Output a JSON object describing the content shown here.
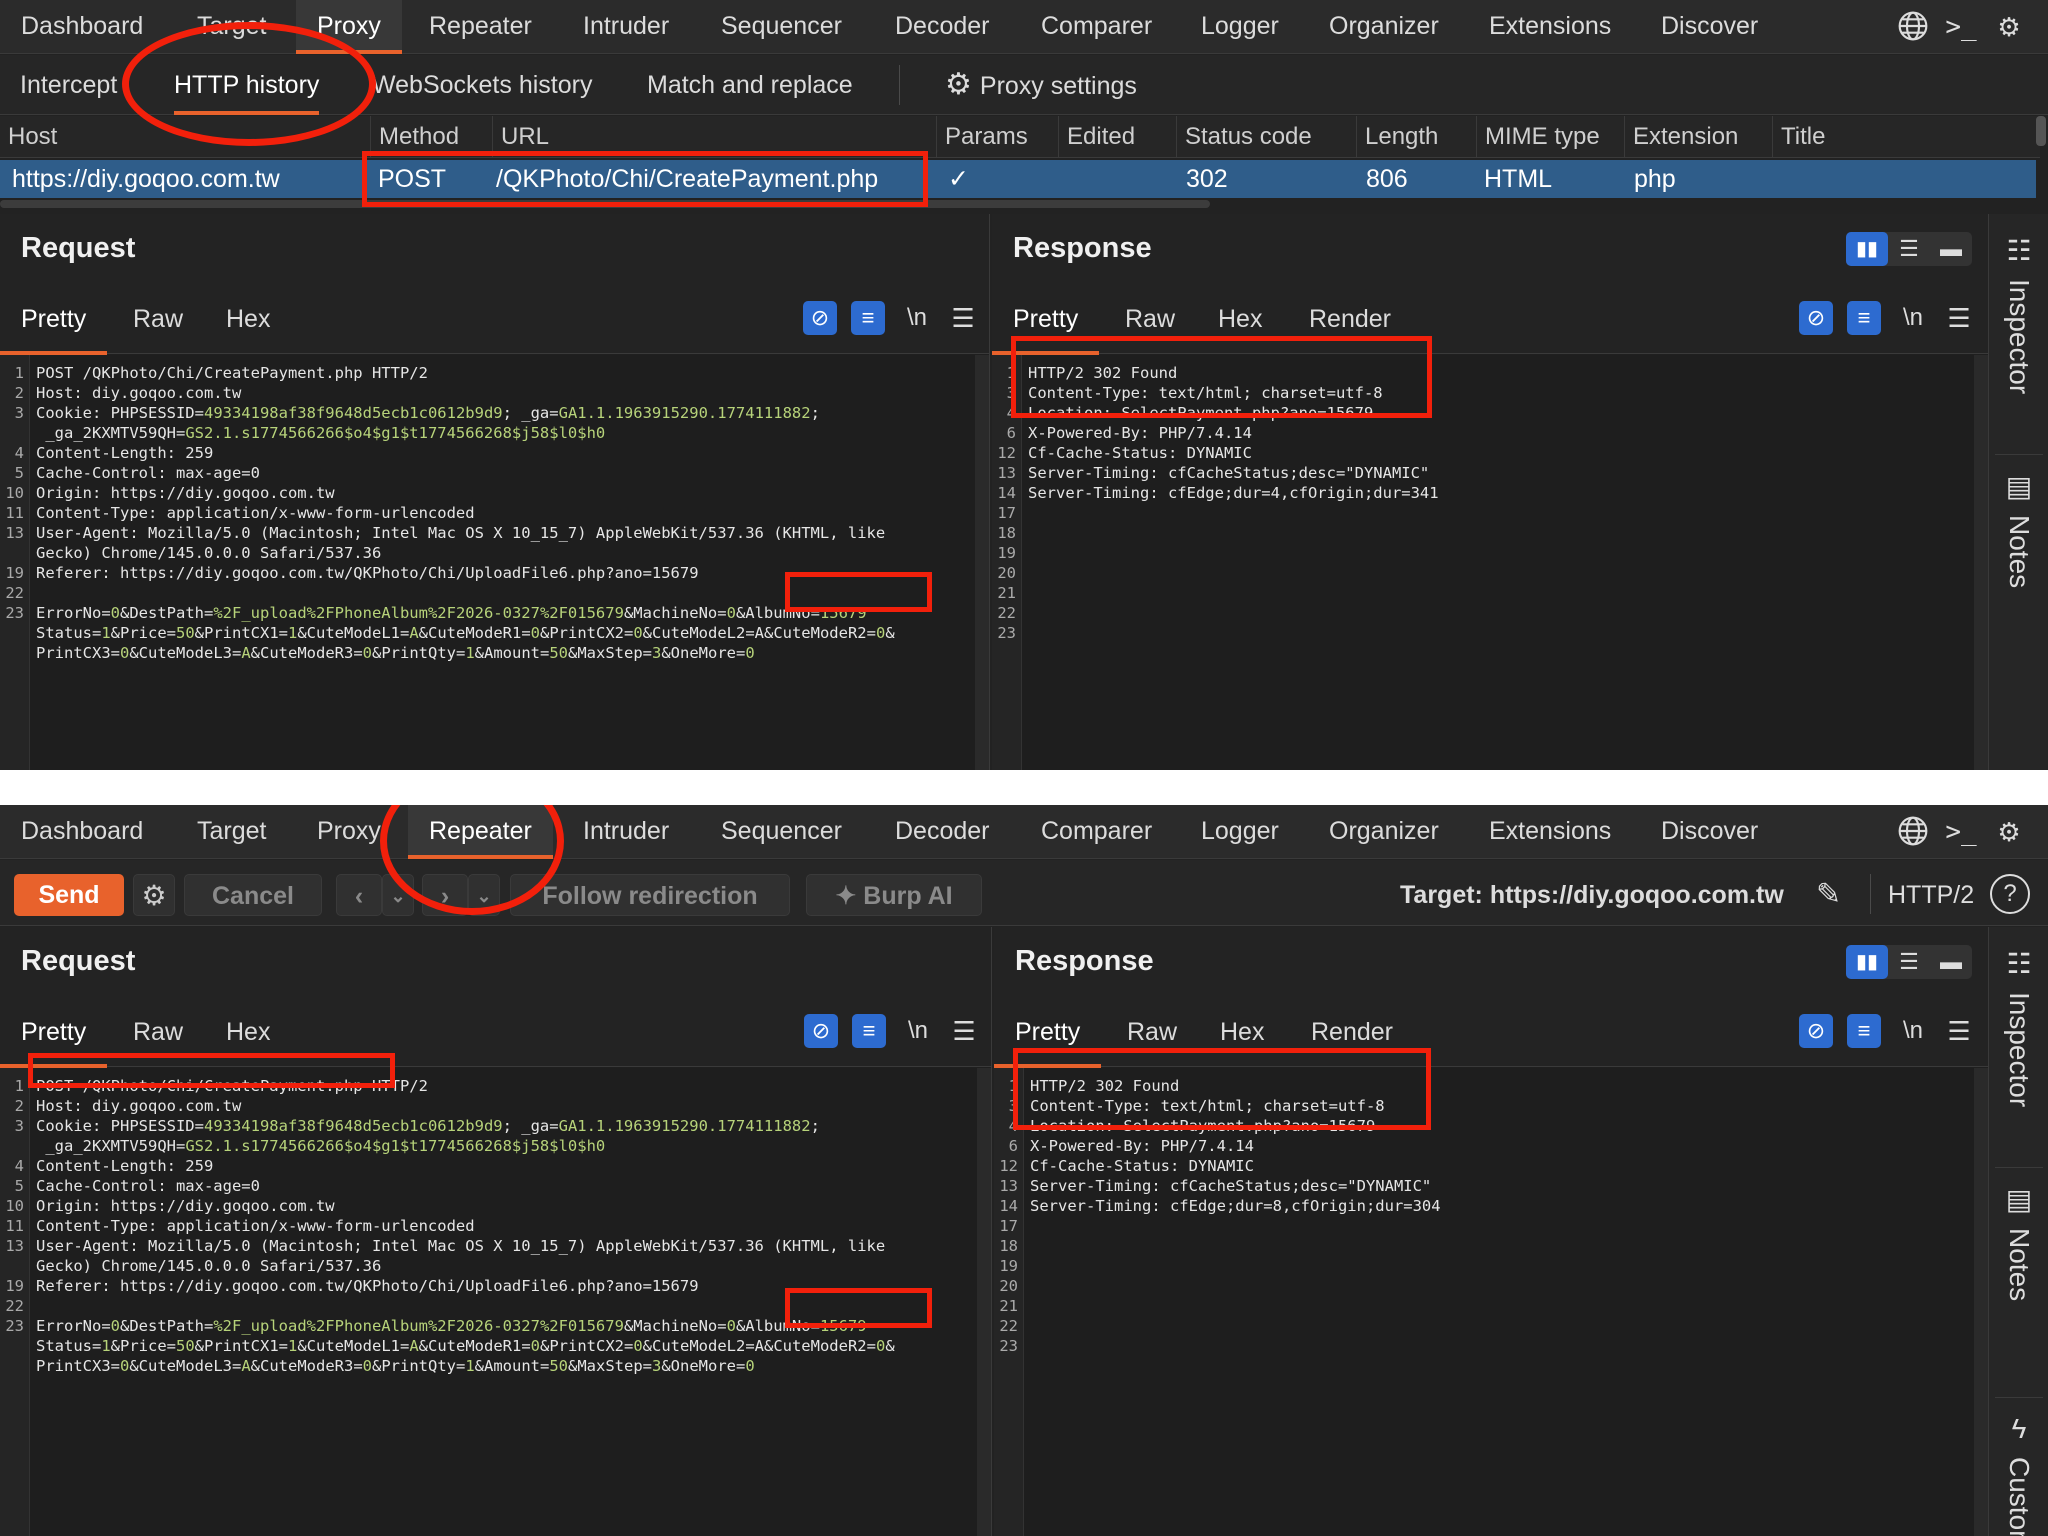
{
  "nav": {
    "tabs": [
      "Dashboard",
      "Target",
      "Proxy",
      "Repeater",
      "Intruder",
      "Sequencer",
      "Decoder",
      "Comparer",
      "Logger",
      "Organizer",
      "Extensions",
      "Discover"
    ]
  },
  "icons": {
    "globe": "globe-icon",
    "terminal": "terminal-icon",
    "gear": "gear-icon"
  },
  "proxy": {
    "subtabs": [
      "Intercept",
      "HTTP history",
      "WebSockets history",
      "Match and replace"
    ],
    "settings": "Proxy settings",
    "columns": [
      "Host",
      "Method",
      "URL",
      "Params",
      "Edited",
      "Status code",
      "Length",
      "MIME type",
      "Extension",
      "Title"
    ],
    "row": {
      "host": "https://diy.goqoo.com.tw",
      "method": "POST",
      "url": "/QKPhoto/Chi/CreatePayment.php",
      "params": "✓",
      "edited": "",
      "status": "302",
      "length": "806",
      "mime": "HTML",
      "ext": "php",
      "title": ""
    }
  },
  "editor": {
    "request_title": "Request",
    "response_title": "Response",
    "req_tabs": [
      "Pretty",
      "Raw",
      "Hex"
    ],
    "resp_tabs": [
      "Pretty",
      "Raw",
      "Hex",
      "Render"
    ],
    "newline_icon": "\\n"
  },
  "sidebar": {
    "inspector": "Inspector",
    "notes": "Notes",
    "custom": "Custom"
  },
  "request1": [
    {
      "n": "1",
      "t": [
        [
          "k",
          "POST /QKPhoto/Chi/CreatePayment.php HTTP/2"
        ]
      ]
    },
    {
      "n": "2",
      "t": [
        [
          "k",
          "Host: diy.goqoo.com.tw"
        ]
      ]
    },
    {
      "n": "3",
      "t": [
        [
          "k",
          "Cookie: PHPSESSID="
        ],
        [
          "g",
          "49334198af38f9648d5ecb1c0612b9d9"
        ],
        [
          "k",
          "; _ga="
        ],
        [
          "g",
          "GA1.1.1963915290.1774111882"
        ],
        [
          "k",
          ";"
        ]
      ]
    },
    {
      "n": "",
      "t": [
        [
          "k",
          " _ga_2KXMTV59QH="
        ],
        [
          "g",
          "GS2.1.s1774566266$o4$g1$t1774566268$j58$l0$h0"
        ]
      ]
    },
    {
      "n": "4",
      "t": [
        [
          "k",
          "Content-Length: 259"
        ]
      ]
    },
    {
      "n": "5",
      "t": [
        [
          "k",
          "Cache-Control: max-age=0"
        ]
      ]
    },
    {
      "n": "10",
      "t": [
        [
          "k",
          "Origin: https://diy.goqoo.com.tw"
        ]
      ]
    },
    {
      "n": "11",
      "t": [
        [
          "k",
          "Content-Type: application/x-www-form-urlencoded"
        ]
      ]
    },
    {
      "n": "13",
      "t": [
        [
          "k",
          "User-Agent: Mozilla/5.0 (Macintosh; Intel Mac OS X 10_15_7) AppleWebKit/537.36 (KHTML, like"
        ]
      ]
    },
    {
      "n": "",
      "t": [
        [
          "k",
          "Gecko) Chrome/145.0.0.0 Safari/537.36"
        ]
      ]
    },
    {
      "n": "19",
      "t": [
        [
          "k",
          "Referer: https://diy.goqoo.com.tw/QKPhoto/Chi/UploadFile6.php?ano=15679"
        ]
      ]
    },
    {
      "n": "22",
      "t": [
        [
          "k",
          ""
        ]
      ]
    },
    {
      "n": "23",
      "t": [
        [
          "k",
          "ErrorNo="
        ],
        [
          "g",
          "0"
        ],
        [
          "k",
          "&DestPath="
        ],
        [
          "g",
          "%2F_upload%2FPhoneAlbum%2F2026-0327%2F015679"
        ],
        [
          "k",
          "&MachineNo="
        ],
        [
          "g",
          "0"
        ],
        [
          "k",
          "&AlbumNo="
        ],
        [
          "g",
          "15679"
        ]
      ]
    },
    {
      "n": "",
      "t": [
        [
          "k",
          "Status="
        ],
        [
          "g",
          "1"
        ],
        [
          "k",
          "&Price="
        ],
        [
          "g",
          "50"
        ],
        [
          "k",
          "&PrintCX1="
        ],
        [
          "g",
          "1"
        ],
        [
          "k",
          "&CuteModeL1="
        ],
        [
          "g",
          "A"
        ],
        [
          "k",
          "&CuteModeR1="
        ],
        [
          "g",
          "0"
        ],
        [
          "k",
          "&PrintCX2="
        ],
        [
          "g",
          "0"
        ],
        [
          "k",
          "&CuteModeL2=A&CuteModeR2="
        ],
        [
          "g",
          "0"
        ],
        [
          "k",
          "&"
        ]
      ]
    },
    {
      "n": "",
      "t": [
        [
          "k",
          "PrintCX3="
        ],
        [
          "g",
          "0"
        ],
        [
          "k",
          "&CuteModeL3="
        ],
        [
          "g",
          "A"
        ],
        [
          "k",
          "&CuteModeR3="
        ],
        [
          "g",
          "0"
        ],
        [
          "k",
          "&PrintQty="
        ],
        [
          "g",
          "1"
        ],
        [
          "k",
          "&Amount="
        ],
        [
          "g",
          "50"
        ],
        [
          "k",
          "&MaxStep="
        ],
        [
          "g",
          "3"
        ],
        [
          "k",
          "&OneMore="
        ],
        [
          "g",
          "0"
        ]
      ]
    }
  ],
  "response1": [
    {
      "n": "1",
      "t": "HTTP/2 302 Found"
    },
    {
      "n": "3",
      "t": "Content-Type: text/html; charset=utf-8"
    },
    {
      "n": "4",
      "t": "Location: SelectPayment.php?ano=15679"
    },
    {
      "n": "6",
      "t": "X-Powered-By: PHP/7.4.14"
    },
    {
      "n": "12",
      "t": "Cf-Cache-Status: DYNAMIC"
    },
    {
      "n": "13",
      "t": "Server-Timing: cfCacheStatus;desc=\"DYNAMIC\""
    },
    {
      "n": "14",
      "t": "Server-Timing: cfEdge;dur=4,cfOrigin;dur=341"
    },
    {
      "n": "17",
      "t": ""
    },
    {
      "n": "18",
      "t": ""
    },
    {
      "n": "19",
      "t": ""
    },
    {
      "n": "20",
      "t": ""
    },
    {
      "n": "21",
      "t": ""
    },
    {
      "n": "22",
      "t": ""
    },
    {
      "n": "23",
      "t": ""
    }
  ],
  "response2": [
    {
      "n": "1",
      "t": "HTTP/2 302 Found"
    },
    {
      "n": "3",
      "t": "Content-Type: text/html; charset=utf-8"
    },
    {
      "n": "4",
      "t": "Location: SelectPayment.php?ano=15679"
    },
    {
      "n": "6",
      "t": "X-Powered-By: PHP/7.4.14"
    },
    {
      "n": "12",
      "t": "Cf-Cache-Status: DYNAMIC"
    },
    {
      "n": "13",
      "t": "Server-Timing: cfCacheStatus;desc=\"DYNAMIC\""
    },
    {
      "n": "14",
      "t": "Server-Timing: cfEdge;dur=8,cfOrigin;dur=304"
    },
    {
      "n": "17",
      "t": ""
    },
    {
      "n": "18",
      "t": ""
    },
    {
      "n": "19",
      "t": ""
    },
    {
      "n": "20",
      "t": ""
    },
    {
      "n": "21",
      "t": ""
    },
    {
      "n": "22",
      "t": ""
    },
    {
      "n": "23",
      "t": ""
    }
  ],
  "repeater": {
    "send": "Send",
    "cancel": "Cancel",
    "follow": "Follow redirection",
    "burpai": "Burp AI",
    "target": "Target: https://diy.goqoo.com.tw",
    "protocol": "HTTP/2"
  },
  "colors": {
    "accent": "#e8622c",
    "selection": "#2f5d8a",
    "annotation": "#f2200b",
    "value": "#b7d37a"
  }
}
